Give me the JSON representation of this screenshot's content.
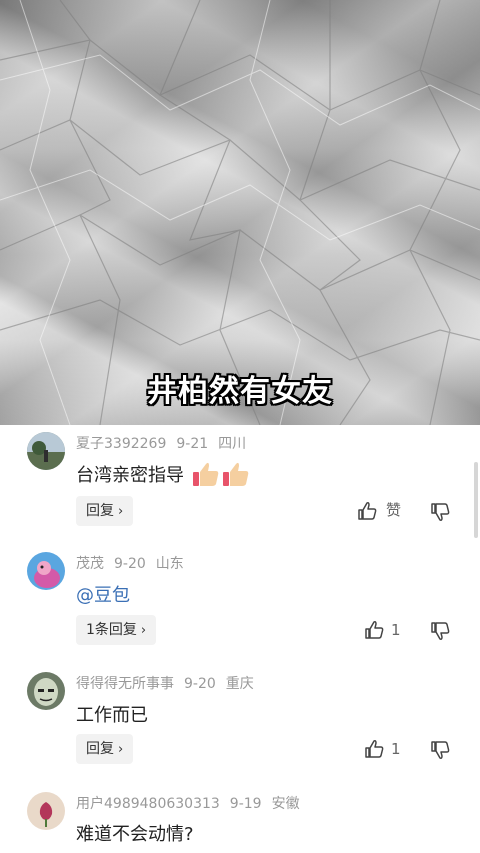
{
  "video": {
    "subtitle": "井柏然有女友"
  },
  "comments": [
    {
      "user": "夏子3392269",
      "date": "9-21",
      "location": "四川",
      "text": "台湾亲密指导",
      "emoji": "thumbs-up thumbs-up",
      "reply_label": "回复",
      "like_label": "赞"
    },
    {
      "user": "茂茂",
      "date": "9-20",
      "location": "山东",
      "text": "@豆包",
      "reply_label": "1条回复",
      "like_count": "1"
    },
    {
      "user": "得得得无所事事",
      "date": "9-20",
      "location": "重庆",
      "text": "工作而已",
      "reply_label": "回复",
      "like_count": "1"
    },
    {
      "user": "用户4989480630313",
      "date": "9-19",
      "location": "安徽",
      "text": "难道不会动情?"
    }
  ],
  "icons": {
    "like": "thumbs-up-outline-icon",
    "dislike": "thumbs-down-outline-icon",
    "chevron": "chevron-right-icon"
  }
}
